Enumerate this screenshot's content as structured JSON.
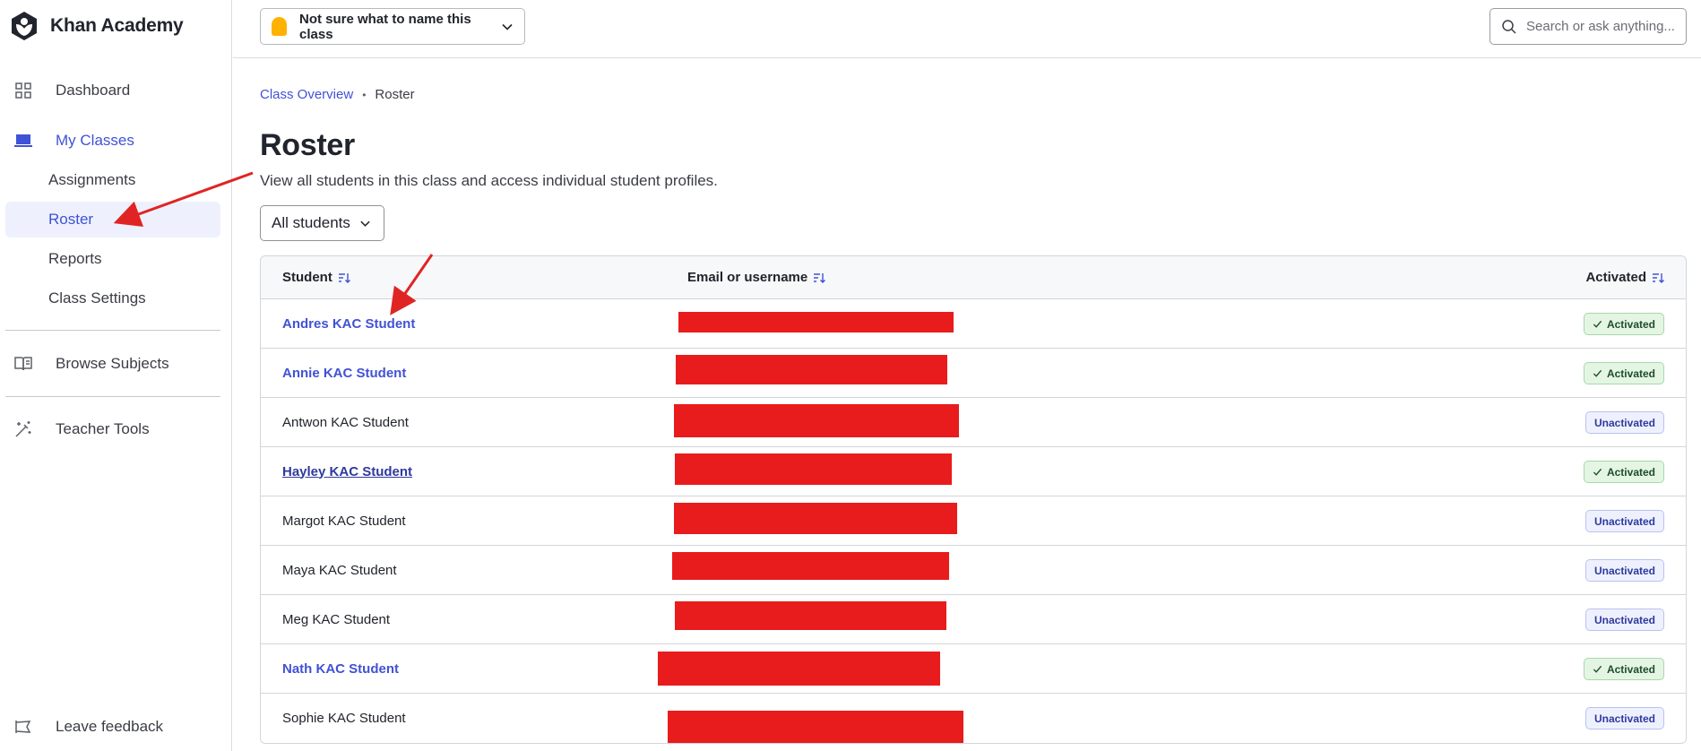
{
  "brand": {
    "name": "Khan Academy"
  },
  "sidebar": {
    "dashboard": "Dashboard",
    "my_classes": "My Classes",
    "sub_items": [
      "Assignments",
      "Roster",
      "Reports",
      "Class Settings"
    ],
    "browse_subjects": "Browse Subjects",
    "teacher_tools": "Teacher Tools",
    "leave_feedback": "Leave feedback"
  },
  "topbar": {
    "class_name": "Not sure what to name this class",
    "search_placeholder": "Search or ask anything..."
  },
  "breadcrumb": {
    "parent": "Class Overview",
    "current": "Roster"
  },
  "page": {
    "title": "Roster",
    "description": "View all students in this class and access individual student profiles.",
    "filter_label": "All students"
  },
  "table": {
    "headers": {
      "student": "Student",
      "email": "Email or username",
      "activated": "Activated"
    },
    "rows": [
      {
        "name": "Andres KAC Student",
        "status": "Activated"
      },
      {
        "name": "Annie KAC Student",
        "status": "Activated"
      },
      {
        "name": "Antwon KAC Student",
        "status": "Unactivated"
      },
      {
        "name": "Hayley KAC Student",
        "status": "Activated"
      },
      {
        "name": "Margot KAC Student",
        "status": "Unactivated"
      },
      {
        "name": "Maya KAC Student",
        "status": "Unactivated"
      },
      {
        "name": "Meg KAC Student",
        "status": "Unactivated"
      },
      {
        "name": "Nath KAC Student",
        "status": "Activated"
      },
      {
        "name": "Sophie KAC Student",
        "status": "Unactivated"
      }
    ]
  },
  "colors": {
    "accent": "#4052d6",
    "redaction": "#e81c1c",
    "logo": "#21242c"
  }
}
